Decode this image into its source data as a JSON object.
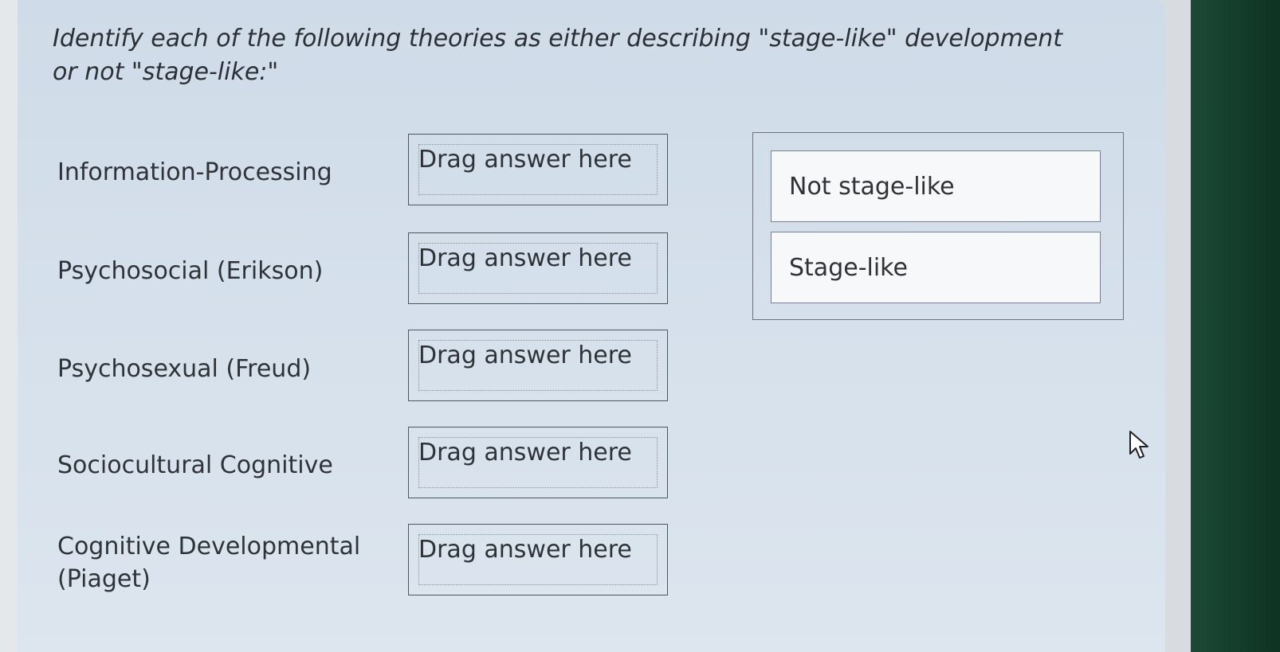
{
  "question": {
    "text": "Identify each of the following theories as either describing \"stage-like\" development or not \"stage-like:\""
  },
  "rows": [
    {
      "label": "Information-Processing",
      "target": "Drag answer here"
    },
    {
      "label": "Psychosocial (Erikson)",
      "target": "Drag answer here"
    },
    {
      "label": "Psychosexual (Freud)",
      "target": "Drag answer here"
    },
    {
      "label": "Sociocultural Cognitive",
      "target": "Drag answer here"
    },
    {
      "label": "Cognitive Developmental (Piaget)",
      "target": "Drag answer here"
    }
  ],
  "answer_bank": {
    "options": [
      "Not stage-like",
      "Stage-like"
    ]
  },
  "icons": {
    "cursor": "arrow-cursor-icon"
  },
  "colors": {
    "panel": "#d6e1ec",
    "border": "#4e5460",
    "chip_bg": "#f7f8f9",
    "bezel": "#15402d"
  }
}
